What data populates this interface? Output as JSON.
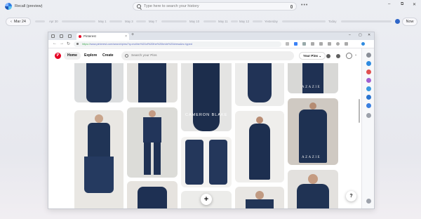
{
  "app": {
    "title": "Recall (preview)"
  },
  "search": {
    "placeholder": "Type here to search your history"
  },
  "window_controls": {
    "minimize": "–",
    "restore": "⧉",
    "close": "✕"
  },
  "timeline": {
    "current_date": "Mar 24",
    "labels": [
      "Apr 30",
      "May 1",
      "May 3",
      "May 7",
      "May 10",
      "May 11",
      "May 12",
      "Yesterday",
      "Today"
    ],
    "now_label": "Now"
  },
  "browser": {
    "tab_title": "Pinterest",
    "url_prefix": "https://",
    "url": "www.pinterest.com/search/pins/?q=mother%20of%20the%20bride%20dress&rs=typed",
    "new_tab": "+"
  },
  "pinterest": {
    "logo": "P",
    "nav": {
      "home": "Home",
      "explore": "Explore",
      "create": "Create"
    },
    "search_placeholder": "Search your Pins",
    "your_pins": "Your Pins ⌄"
  },
  "pins": {
    "brand_1": "CAMERON BLAKE",
    "brand_2": "AZAZIE",
    "brand_3": "AZAZIE",
    "fab_label": "+",
    "help_label": "?"
  },
  "colors": {
    "navy": "#1e3256",
    "navy_dark": "#17253f",
    "pinterest_red": "#e60023",
    "recall_accent": "#2f66c8"
  }
}
